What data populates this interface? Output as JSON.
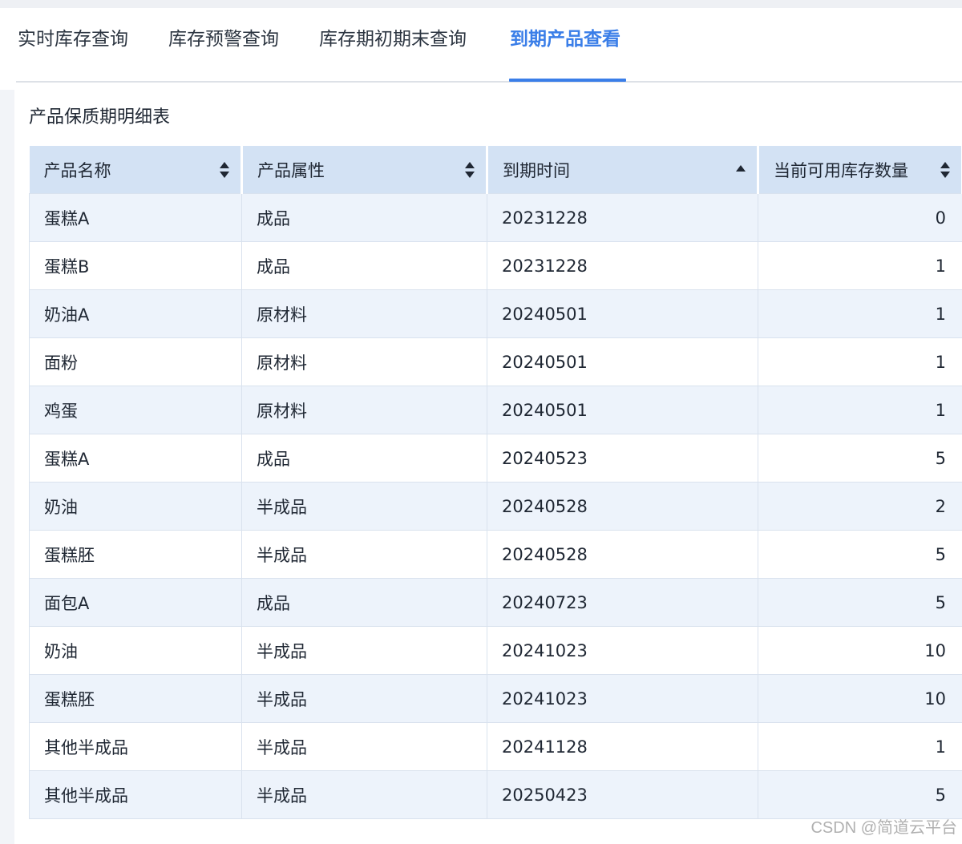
{
  "tabs": [
    {
      "label": "实时库存查询"
    },
    {
      "label": "库存预警查询"
    },
    {
      "label": "库存期初期末查询"
    },
    {
      "label": "到期产品查看"
    }
  ],
  "active_tab": "到期产品查看",
  "accent_color": "#3a7ee8",
  "panel": {
    "title": "产品保质期明细表"
  },
  "table": {
    "columns": [
      {
        "label": "产品名称",
        "sort": "both"
      },
      {
        "label": "产品属性",
        "sort": "both"
      },
      {
        "label": "到期时间",
        "sort": "asc"
      },
      {
        "label": "当前可用库存数量",
        "sort": "both"
      }
    ],
    "rows": [
      [
        "蛋糕A",
        "成品",
        "20231228",
        "0"
      ],
      [
        "蛋糕B",
        "成品",
        "20231228",
        "1"
      ],
      [
        "奶油A",
        "原材料",
        "20240501",
        "1"
      ],
      [
        "面粉",
        "原材料",
        "20240501",
        "1"
      ],
      [
        "鸡蛋",
        "原材料",
        "20240501",
        "1"
      ],
      [
        "蛋糕A",
        "成品",
        "20240523",
        "5"
      ],
      [
        "奶油",
        "半成品",
        "20240528",
        "2"
      ],
      [
        "蛋糕胚",
        "半成品",
        "20240528",
        "5"
      ],
      [
        "面包A",
        "成品",
        "20240723",
        "5"
      ],
      [
        "奶油",
        "半成品",
        "20241023",
        "10"
      ],
      [
        "蛋糕胚",
        "半成品",
        "20241023",
        "10"
      ],
      [
        "其他半成品",
        "半成品",
        "20241128",
        "1"
      ],
      [
        "其他半成品",
        "半成品",
        "20250423",
        "5"
      ]
    ]
  },
  "watermark": "CSDN @简道云平台"
}
